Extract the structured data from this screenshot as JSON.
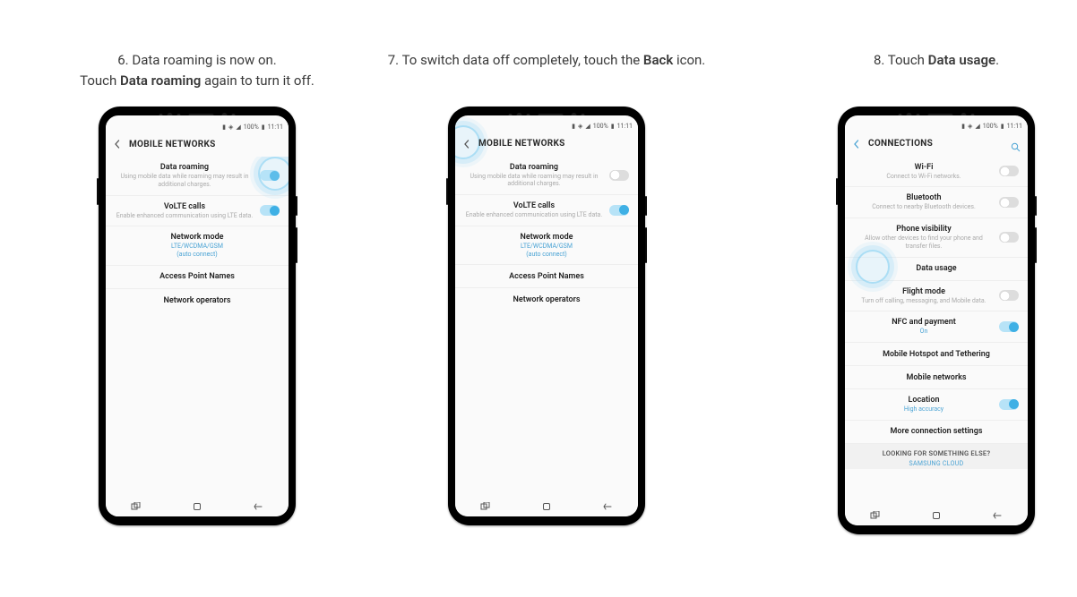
{
  "steps": [
    {
      "num": "6.",
      "caption_pre": "Data roaming is now on.",
      "caption_line2_pre": "Touch ",
      "caption_bold": "Data roaming",
      "caption_line2_post": " again to turn it off."
    },
    {
      "num": "7.",
      "caption_pre": "To switch data off completely, touch the ",
      "caption_bold": "Back",
      "caption_post": " icon."
    },
    {
      "num": "8.",
      "caption_pre": "Touch ",
      "caption_bold": "Data usage",
      "caption_post": "."
    }
  ],
  "status": {
    "signal": "▮",
    "wifi": "◈",
    "net": "◢",
    "batt_text": "100%",
    "batt": "▮",
    "time": "11:11"
  },
  "mobile_networks": {
    "header": "MOBILE NETWORKS",
    "rows": {
      "data_roaming": {
        "title": "Data roaming",
        "sub": "Using mobile data while roaming may result in additional charges."
      },
      "volte": {
        "title": "VoLTE calls",
        "sub": "Enable enhanced communication using LTE data."
      },
      "network_mode": {
        "title": "Network mode",
        "sub1": "LTE/WCDMA/GSM",
        "sub2": "(auto connect)"
      },
      "apn": {
        "title": "Access Point Names"
      },
      "operators": {
        "title": "Network operators"
      }
    }
  },
  "connections": {
    "header": "CONNECTIONS",
    "rows": {
      "wifi": {
        "title": "Wi-Fi",
        "sub": "Connect to Wi-Fi networks."
      },
      "bt": {
        "title": "Bluetooth",
        "sub": "Connect to nearby Bluetooth devices."
      },
      "vis": {
        "title": "Phone visibility",
        "sub": "Allow other devices to find your phone and transfer files."
      },
      "data": {
        "title": "Data usage"
      },
      "flight": {
        "title": "Flight mode",
        "sub": "Turn off calling, messaging, and Mobile data."
      },
      "nfc": {
        "title": "NFC and payment",
        "sub": "On"
      },
      "hotspot": {
        "title": "Mobile Hotspot and Tethering"
      },
      "mn": {
        "title": "Mobile networks"
      },
      "loc": {
        "title": "Location",
        "sub": "High accuracy"
      },
      "more": {
        "title": "More connection settings"
      }
    },
    "footer": {
      "title": "LOOKING FOR SOMETHING ELSE?",
      "sub": "SAMSUNG CLOUD"
    }
  }
}
